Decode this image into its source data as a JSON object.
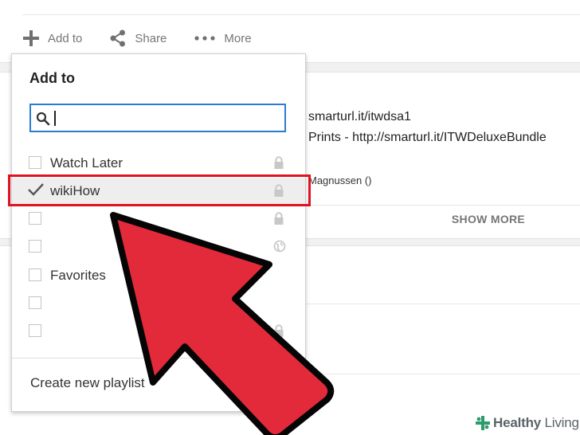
{
  "action_bar": {
    "add_to_label": "Add to",
    "share_label": "Share",
    "more_label": "More"
  },
  "description": {
    "line1": "smarturl.it/itwdsa1",
    "line2": "Prints - http://smarturl.it/ITWDeluxeBundle",
    "credit": "Magnussen ()",
    "show_more": "SHOW MORE"
  },
  "panel": {
    "title": "Add to",
    "search": {
      "value": "",
      "placeholder": ""
    },
    "playlists": [
      {
        "label": "Watch Later",
        "checked": false,
        "privacy": "lock-icon"
      },
      {
        "label": "wikiHow",
        "checked": true,
        "privacy": "lock-icon"
      },
      {
        "label": "",
        "checked": false,
        "privacy": "lock-icon"
      },
      {
        "label": "",
        "checked": false,
        "privacy": "globe-icon"
      },
      {
        "label": "Favorites",
        "checked": false,
        "privacy": ""
      },
      {
        "label": "",
        "checked": false,
        "privacy": ""
      },
      {
        "label": "",
        "checked": false,
        "privacy": "lock-icon"
      }
    ],
    "create_label": "Create new playlist"
  },
  "annotation": {
    "highlight_color": "#e0121f",
    "arrow_color": "#e22a3a"
  },
  "watermark": {
    "brand_bold": "Healthy",
    "brand_light": "Living"
  }
}
